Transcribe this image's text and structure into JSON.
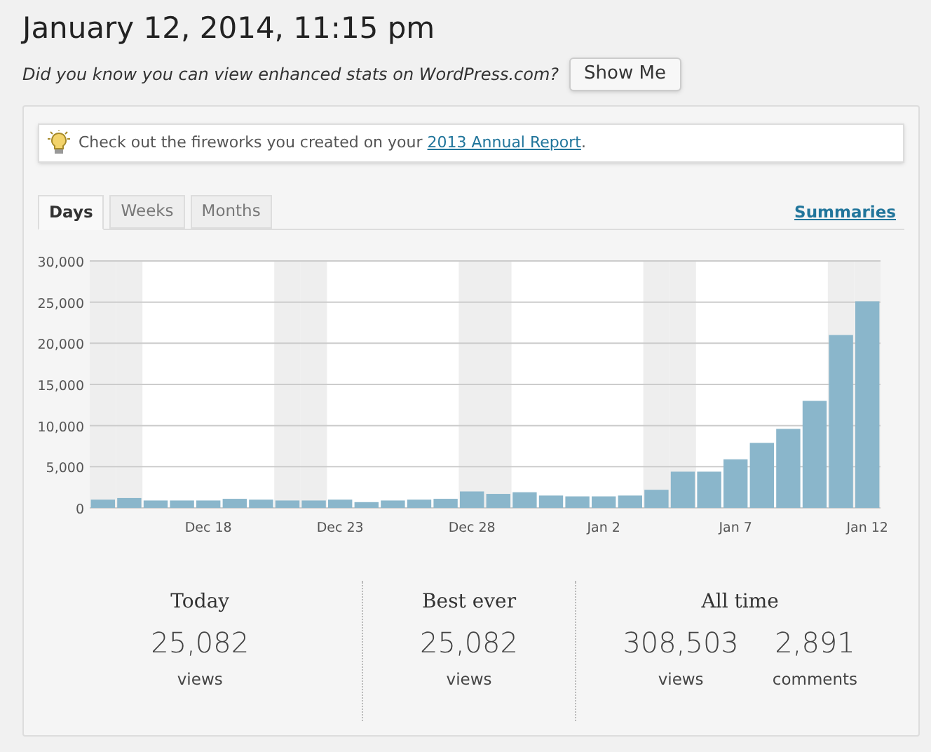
{
  "title": "January 12, 2014, 11:15 pm",
  "promo": {
    "text": "Did you know you can view enhanced stats on WordPress.com?",
    "button": "Show Me"
  },
  "notice": {
    "text": "Check out the fireworks you created on your ",
    "link": "2013 Annual Report",
    "suffix": "."
  },
  "tabs": [
    {
      "label": "Days",
      "selected": true
    },
    {
      "label": "Weeks",
      "selected": false
    },
    {
      "label": "Months",
      "selected": false
    }
  ],
  "summaries_link": "Summaries",
  "chart_data": {
    "type": "bar",
    "categories": [
      null,
      null,
      null,
      null,
      "Dec 18",
      null,
      null,
      null,
      null,
      "Dec 23",
      null,
      null,
      null,
      null,
      "Dec 28",
      null,
      null,
      null,
      null,
      "Jan 2",
      null,
      null,
      null,
      null,
      "Jan 7",
      null,
      null,
      null,
      null,
      "Jan 12"
    ],
    "series": [
      {
        "color": "#8ab6cb",
        "values": [
          1000,
          1200,
          900,
          900,
          900,
          1100,
          1000,
          900,
          900,
          1000,
          700,
          900,
          1000,
          1100,
          2000,
          1700,
          1900,
          1500,
          1400,
          1400,
          1500,
          2200,
          4400,
          4400,
          5900,
          7900,
          9600,
          13000,
          21000,
          25100
        ]
      }
    ],
    "ylim": [
      0,
      30000
    ],
    "grid": true,
    "yticks": [
      {
        "value": 0,
        "label": "0"
      },
      {
        "value": 5000,
        "label": "5,000"
      },
      {
        "value": 10000,
        "label": "10,000"
      },
      {
        "value": 15000,
        "label": "15,000"
      },
      {
        "value": 20000,
        "label": "20,000"
      },
      {
        "value": 25000,
        "label": "25,000"
      },
      {
        "value": 30000,
        "label": "30,000"
      }
    ]
  },
  "stats": [
    {
      "heading": "Today",
      "figures": [
        {
          "value": "25,082",
          "unit": "views"
        }
      ]
    },
    {
      "heading": "Best ever",
      "figures": [
        {
          "value": "25,082",
          "unit": "views"
        }
      ]
    },
    {
      "heading": "All time",
      "figures": [
        {
          "value": "308,503",
          "unit": "views"
        },
        {
          "value": "2,891",
          "unit": "comments"
        }
      ]
    }
  ]
}
